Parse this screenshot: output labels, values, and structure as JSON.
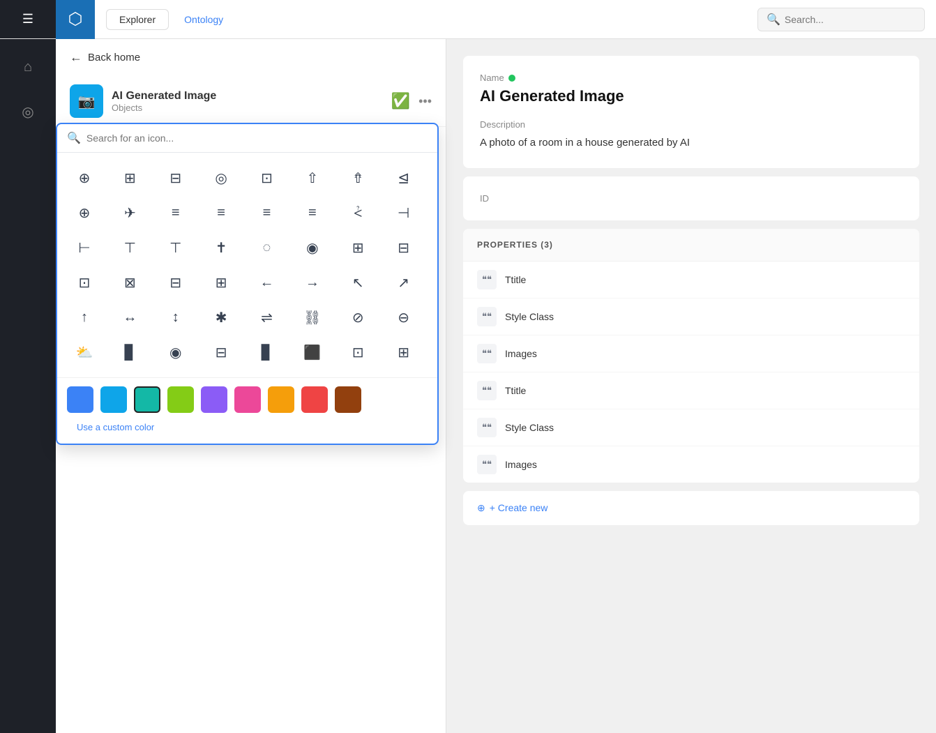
{
  "topbar": {
    "hamburger": "☰",
    "logo": "⬡",
    "tabs": [
      {
        "label": "Explorer",
        "active": false
      },
      {
        "label": "Ontology",
        "active": true
      }
    ],
    "search_placeholder": "Search..."
  },
  "sidebar": {
    "icons": [
      "⌂",
      "◎"
    ]
  },
  "back_nav": {
    "label": "Back home"
  },
  "entity": {
    "name": "AI Generated Image",
    "type": "Objects",
    "icon": "📷"
  },
  "icon_picker": {
    "search_placeholder": "Search for an icon...",
    "icons": [
      "⊕",
      "⊞",
      "⊟",
      "◎",
      "⊡",
      "⇧",
      "⇮",
      "⊴",
      "⊕",
      "✈",
      "≡",
      "≡",
      "⋮",
      "⋮",
      "⩻",
      "⊣",
      "⊣",
      "⊤",
      "⊤",
      "☑",
      "◉",
      "⊞",
      "⊜",
      "⊢",
      "⊤",
      "⊤",
      "✝",
      "◌",
      "◉",
      "⊞",
      "⊟",
      "⊡",
      "⊠",
      "⊟",
      "⊞",
      "←",
      "→",
      "↖",
      "↗",
      "↑",
      "↔",
      "↕",
      "✱",
      "⇌",
      "⛓",
      "⊘",
      "⊖",
      "⛅",
      "▊",
      "◉",
      "⊟",
      "▊",
      "⬛",
      "⊡"
    ],
    "colors": [
      {
        "hex": "#3b82f6",
        "label": "blue"
      },
      {
        "hex": "#0ea5e9",
        "label": "sky"
      },
      {
        "hex": "#14b8a6",
        "label": "teal",
        "active": true
      },
      {
        "hex": "#84cc16",
        "label": "lime"
      },
      {
        "hex": "#8b5cf6",
        "label": "purple"
      },
      {
        "hex": "#ec4899",
        "label": "pink"
      },
      {
        "hex": "#f59e0b",
        "label": "amber"
      },
      {
        "hex": "#ef4444",
        "label": "red"
      },
      {
        "hex": "#92400e",
        "label": "brown"
      }
    ],
    "custom_color_label": "Use a custom color"
  },
  "detail": {
    "name_label": "Name",
    "title": "AI Generated Image",
    "description_label": "Description",
    "description": "A photo of a room in a house generated by AI",
    "id_label": "ID"
  },
  "properties": {
    "header": "PROPERTIES (3)",
    "items": [
      {
        "icon": "❝❝",
        "name": "Ttitle"
      },
      {
        "icon": "❝❝",
        "name": "Style Class"
      },
      {
        "icon": "❝❝",
        "name": "Images"
      },
      {
        "icon": "❝❝",
        "name": "Ttitle"
      },
      {
        "icon": "❝❝",
        "name": "Style Class"
      },
      {
        "icon": "❝❝",
        "name": "Images"
      }
    ],
    "create_new": "+ Create new"
  },
  "grid_icons_row1": [
    "⊕",
    "⊞",
    "⊟",
    "◎",
    "⊡",
    "⇧",
    "⇮",
    "⊴"
  ],
  "grid_icons_row2": [
    "⊕",
    "✈",
    "≡",
    "≡",
    "≡",
    "≡",
    "⩻",
    "⊣"
  ],
  "grid_icons_row3": [
    "⊢",
    "⊤",
    "⊤",
    "✝",
    "◌",
    "◉",
    "⊞",
    "⊟"
  ],
  "grid_icons_row4": [
    "⊡",
    "⊠",
    "⊟",
    "⊞",
    "←",
    "→",
    "↖",
    "↗"
  ],
  "grid_icons_row5": [
    "↑",
    "↔",
    "↕",
    "✱",
    "⇌",
    "⛓",
    "⊘",
    "⊖"
  ],
  "grid_icons_row6": [
    "⛅",
    "▊",
    "◉",
    "⊟",
    "▊",
    "⬛",
    "⊡",
    "⊞"
  ]
}
